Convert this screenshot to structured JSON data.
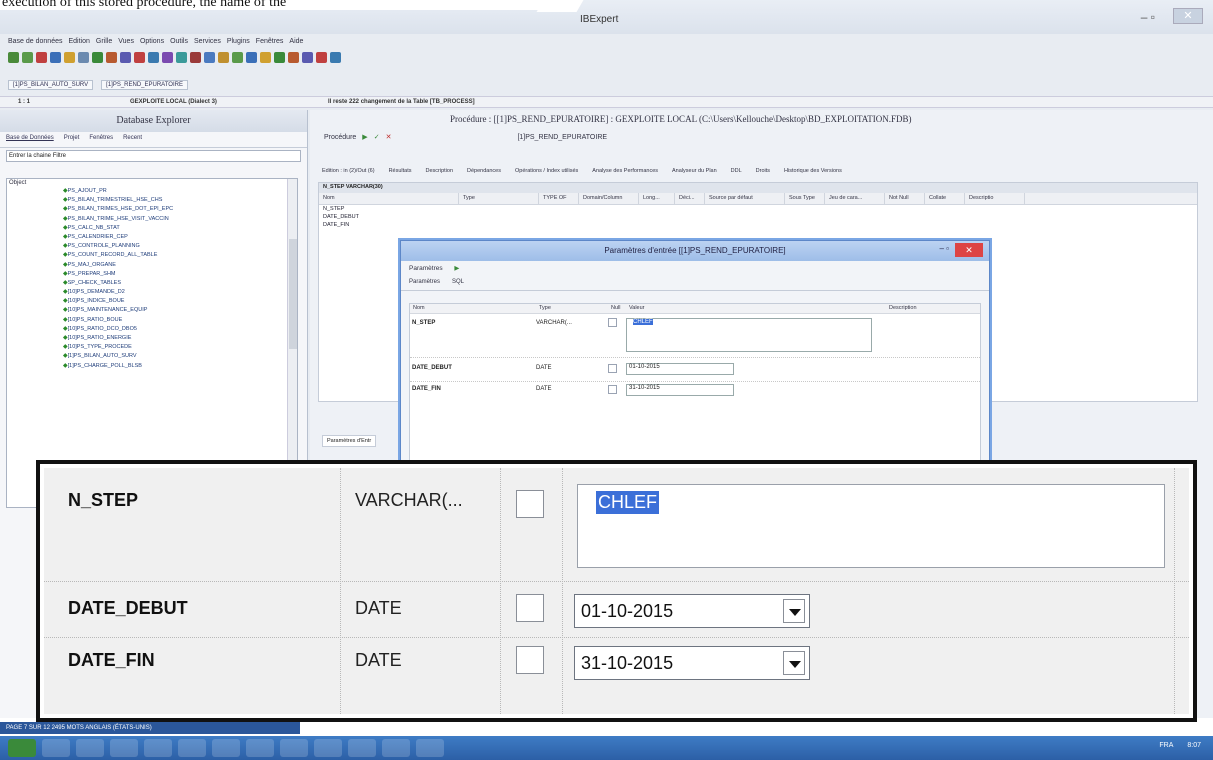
{
  "caption": "execution of this stored procedure, the name of the",
  "window": {
    "title": "IBExpert"
  },
  "menu": [
    "Base de données",
    "Edition",
    "Grille",
    "Vues",
    "Options",
    "Outils",
    "Services",
    "Plugins",
    "Fenêtres",
    "Aide"
  ],
  "connections": [
    "[1]PS_BILAN_AUTO_SURV",
    "[1]PS_REND_EPURATOIRE"
  ],
  "status": {
    "line": "1 : 1",
    "db": "GEXPLOITE LOCAL (Dialect 3)",
    "message": "Il reste 222 changement de la Table [TB_PROCESS]"
  },
  "explorer": {
    "title": "Database Explorer",
    "tabs": [
      "Base de Données",
      "Projet",
      "Fenêtres",
      "Recent"
    ],
    "filter_placeholder": "Entrer la chaine Filtre",
    "tree_header": "Object",
    "items": [
      "PS_AJOUT_PR",
      "PS_BILAN_TRIMESTRIEL_HSE_CHS",
      "PS_BILAN_TRIMES_HSE_DOT_EPI_EPC",
      "PS_BILAN_TRIME_HSE_VISIT_VACCIN",
      "PS_CALC_NB_STAT",
      "PS_CALENDRIER_CEP",
      "PS_CONTROLE_PLANNING",
      "PS_COUNT_RECORD_ALL_TABLE",
      "PS_MAJ_ORGANE",
      "PS_PREPAR_SHM",
      "SP_CHECK_TABLES",
      "[10]PS_DEMANDE_D2",
      "[10]PS_INDICE_BOUE",
      "[10]PS_MAINTENANCE_EQUIP",
      "[10]PS_RATIO_BOUE",
      "[10]PS_RATIO_DCO_DBO5",
      "[10]PS_RATIO_ENERGIE",
      "[10]PS_TYPE_PROCEDE",
      "[1]PS_BILAN_AUTO_SURV",
      "[1]PS_CHARGE_POLL_BLSB"
    ]
  },
  "procedure": {
    "title": "Procédure : [[1]PS_REND_EPURATOIRE] : GEXPLOITE LOCAL (C:\\Users\\Kellouche\\Desktop\\BD_EXPLOITATION.FDB)",
    "menu_label": "Procédure",
    "name_field": "[1]PS_REND_EPURATOIRE",
    "tabs": [
      "Edition : in (2)/Out (6)",
      "Résultats",
      "Description",
      "Dépendances",
      "Opérations / Index utilisés",
      "Analyse des Performances",
      "Analyseur du Plan",
      "DDL",
      "Droits",
      "Historique des Versions"
    ],
    "section": "N_STEP VARCHAR(30)",
    "columns": [
      "Nom",
      "Type",
      "TYPE OF",
      "Domain/Column",
      "Long...",
      "Déci...",
      "Source par défaut",
      "Sous Type",
      "Jeu de cara...",
      "Not Null",
      "Collate",
      "Descriptio"
    ],
    "params": [
      "N_STEP",
      "DATE_DEBUT",
      "DATE_FIN"
    ],
    "bottom_tab": "Paramètres d'Entr"
  },
  "dialog": {
    "title": "Paramètres d'entrée [[1]PS_REND_EPURATOIRE]",
    "toolbar_label": "Paramètres",
    "tabs": [
      "Paramètres",
      "SQL"
    ],
    "columns": [
      "Nom",
      "Type",
      "Null",
      "Valeur",
      "Description"
    ],
    "rows": [
      {
        "name": "N_STEP",
        "type": "VARCHAR(...",
        "value": "CHLEF"
      },
      {
        "name": "DATE_DEBUT",
        "type": "DATE",
        "value": "01-10-2015"
      },
      {
        "name": "DATE_FIN",
        "type": "DATE",
        "value": "31-10-2015"
      }
    ]
  },
  "zoom": {
    "rows": [
      {
        "name": "N_STEP",
        "type": "VARCHAR(...",
        "value": "CHLEF"
      },
      {
        "name": "DATE_DEBUT",
        "type": "DATE",
        "value": "01-10-2015"
      },
      {
        "name": "DATE_FIN",
        "type": "DATE",
        "value": "31-10-2015"
      }
    ]
  },
  "wordbar": "PAGE 7 SUR 12   2495 MOTS   ANGLAIS (ÉTATS-UNIS)",
  "tray": {
    "lang": "FRA",
    "time": "8:07"
  },
  "colors": {
    "selection": "#3b6fd8",
    "taskbar": "#2c5fa6",
    "dialog_border": "#5d87c8"
  }
}
